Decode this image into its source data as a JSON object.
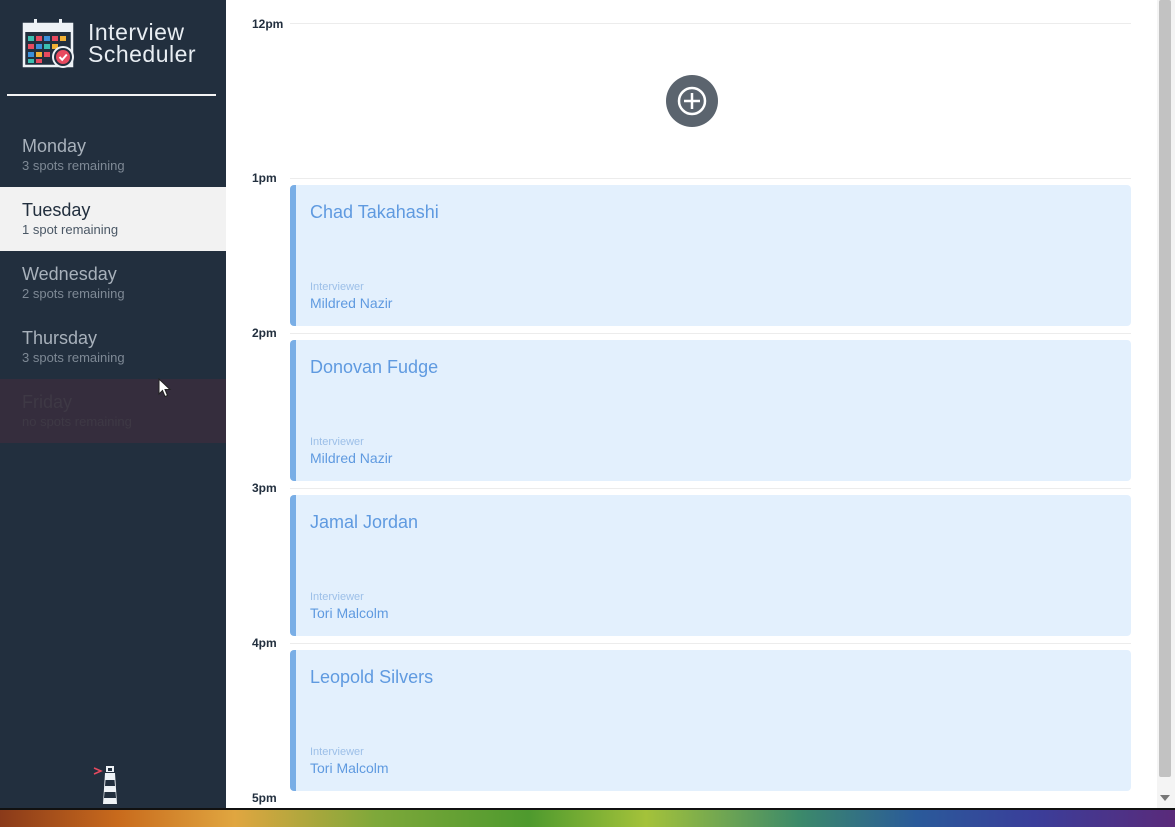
{
  "app": {
    "title_line1": "Interview",
    "title_line2": "Scheduler"
  },
  "sidebar": {
    "days": [
      {
        "name": "Monday",
        "spots": "3 spots remaining",
        "state": "normal"
      },
      {
        "name": "Tuesday",
        "spots": "1 spot remaining",
        "state": "selected"
      },
      {
        "name": "Wednesday",
        "spots": "2 spots remaining",
        "state": "normal"
      },
      {
        "name": "Thursday",
        "spots": "3 spots remaining",
        "state": "normal"
      },
      {
        "name": "Friday",
        "spots": "no spots remaining",
        "state": "full"
      }
    ]
  },
  "schedule": {
    "hours": [
      "12pm",
      "1pm",
      "2pm",
      "3pm",
      "4pm",
      "5pm"
    ],
    "appointments": [
      {
        "student": "Chad Takahashi",
        "interviewer_label": "Interviewer",
        "interviewer": "Mildred Nazir"
      },
      {
        "student": "Donovan Fudge",
        "interviewer_label": "Interviewer",
        "interviewer": "Mildred Nazir"
      },
      {
        "student": "Jamal Jordan",
        "interviewer_label": "Interviewer",
        "interviewer": "Tori Malcolm"
      },
      {
        "student": "Leopold Silvers",
        "interviewer_label": "Interviewer",
        "interviewer": "Tori Malcolm"
      }
    ]
  },
  "colors": {
    "sidebar_bg": "#222f3e",
    "appointment_bg": "#e3f0fd",
    "appointment_accent": "#79aee6",
    "add_button": "#5b646e"
  },
  "icons": {
    "logo": "calendar-check-icon",
    "add": "plus-circle-icon",
    "footer": "lighthouse-icon",
    "pointer": "mouse-cursor-icon"
  }
}
